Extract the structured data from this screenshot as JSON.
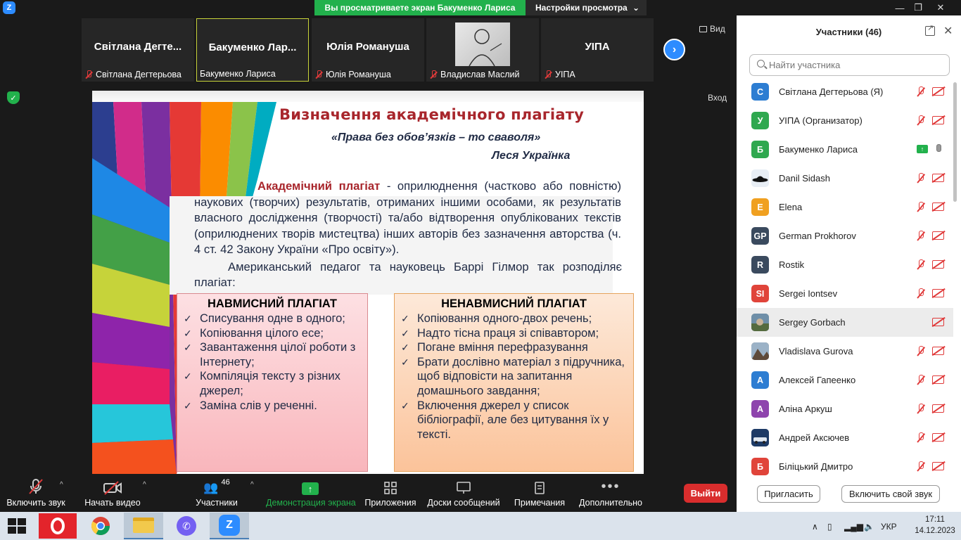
{
  "window": {
    "share_banner": "Вы просматриваете экран Бакуменко Лариса",
    "view_options": "Настройки просмотра",
    "zoom_glyph": "Z",
    "caret": "⌄",
    "controls": {
      "minimize": "—",
      "restore": "❐",
      "close": "✕"
    }
  },
  "video_strip": {
    "tiles": [
      {
        "name": "Світлана  Дегте...",
        "label": "Світлана Дегтерьова",
        "muted": true
      },
      {
        "name": "Бакуменко  Лар...",
        "label": "Бакуменко Лариса",
        "muted": false
      },
      {
        "name": "Юлія Романуша",
        "label": "Юлія Романуша",
        "muted": true
      },
      {
        "name": "",
        "label": "Владислав Маслий",
        "muted": true
      },
      {
        "name": "УІПА",
        "label": "УІПА",
        "muted": true
      }
    ],
    "next_glyph": "›",
    "view_label": "Вид",
    "enter_label": "Вход",
    "shield_glyph": "✓"
  },
  "slide": {
    "title": "Визначення академічного плагіату",
    "epigraph": "«Права без обов’язків – то сваволя»",
    "epigraph_author": "Леся Українка",
    "definition_term": "Академічний плагіат",
    "definition_text": " - оприлюднення (частково або повністю) наукових (творчих) результатів, отриманих іншими особами, як результатів власного дослідження (творчості) та/або відтворення опублікованих текстів (оприлюднених творів мистецтва) інших авторів без зазначення авторства (ч. 4 ст. 42 Закону України «Про освіту»).",
    "intro": "Американський педагог та науковець Баррі Гілмор так розподіляє плагіат:",
    "check_glyph": "✓",
    "boxes": [
      {
        "title": "НАВМИСНИЙ ПЛАГІАТ",
        "items": [
          "Списування одне в одного;",
          "Копіювання цілого есе;",
          "Завантаження цілої роботи з Інтернету;",
          "Компіляція тексту з різних джерел;",
          "Заміна слів у реченні."
        ]
      },
      {
        "title": "НЕНАВМИСНИЙ ПЛАГІАТ",
        "items": [
          "Копіювання одного-двох речень;",
          "Надто тісна праця зі співавтором;",
          "Погане вміння перефразування",
          "Брати дослівно матеріал з підручника, щоб відповісти на запитання домашнього завдання;",
          "Включення джерел у список бібліографії, але без цитування їх у тексті."
        ]
      }
    ]
  },
  "participants": {
    "title": "Участники (46)",
    "close_glyph": "✕",
    "search_placeholder": "Найти участника",
    "list": [
      {
        "initials": "С",
        "color": "#2d7dd2",
        "name": "Світлана Дегтерьова (Я)",
        "status": "muted"
      },
      {
        "initials": "У",
        "color": "#2fa84f",
        "name": "УІПА (Организатор)",
        "status": "muted"
      },
      {
        "initials": "Б",
        "color": "#2fa84f",
        "name": "Бакуменко Лариса",
        "status": "sharing"
      },
      {
        "initials": "",
        "color": "#ffffff",
        "name": "Danil Sidash",
        "status": "muted",
        "picture": "hat"
      },
      {
        "initials": "E",
        "color": "#f0a020",
        "name": "Elena",
        "status": "muted"
      },
      {
        "initials": "GP",
        "color": "#3a4a5e",
        "name": "German Prokhorov",
        "status": "muted"
      },
      {
        "initials": "R",
        "color": "#3a4a5e",
        "name": "Rostik",
        "status": "muted"
      },
      {
        "initials": "SI",
        "color": "#e0443a",
        "name": "Sergei Iontsev",
        "status": "muted"
      },
      {
        "initials": "",
        "color": "#7a8a70",
        "name": "Sergey Gorbach",
        "status": "cam-only",
        "picture": "photo",
        "highlight": true
      },
      {
        "initials": "",
        "color": "#8a7a6a",
        "name": "Vladislava Gurova",
        "status": "muted",
        "picture": "landscape"
      },
      {
        "initials": "А",
        "color": "#2d7dd2",
        "name": "Алексей Гапеенко",
        "status": "muted"
      },
      {
        "initials": "А",
        "color": "#8e44ad",
        "name": "Аліна Аркуш",
        "status": "muted"
      },
      {
        "initials": "",
        "color": "#2a4a7a",
        "name": "Андрей Аксючев",
        "status": "muted",
        "picture": "car"
      },
      {
        "initials": "Б",
        "color": "#e0443a",
        "name": "Біліцький Дмитро",
        "status": "muted"
      }
    ],
    "invite_label": "Пригласить",
    "unmute_label": "Включить свой звук"
  },
  "toolbar": {
    "mute_label": "Включить звук",
    "video_label": "Начать видео",
    "participants_label": "Участники",
    "participants_count": "46",
    "share_label": "Демонстрация экрана",
    "apps_label": "Приложения",
    "whiteboards_label": "Доски сообщений",
    "notes_label": "Примечания",
    "more_label": "Дополнительно",
    "leave_label": "Выйти",
    "caret": "^",
    "share_arrow": "↑"
  },
  "taskbar": {
    "language": "УКР",
    "time": "17:11",
    "date": "14.12.2023",
    "tray_up": "∧"
  },
  "colors": {
    "accent": "#2d8cff",
    "share_green": "#22b14c",
    "leave_red": "#d92d2d",
    "slide_title": "#a8262c"
  }
}
